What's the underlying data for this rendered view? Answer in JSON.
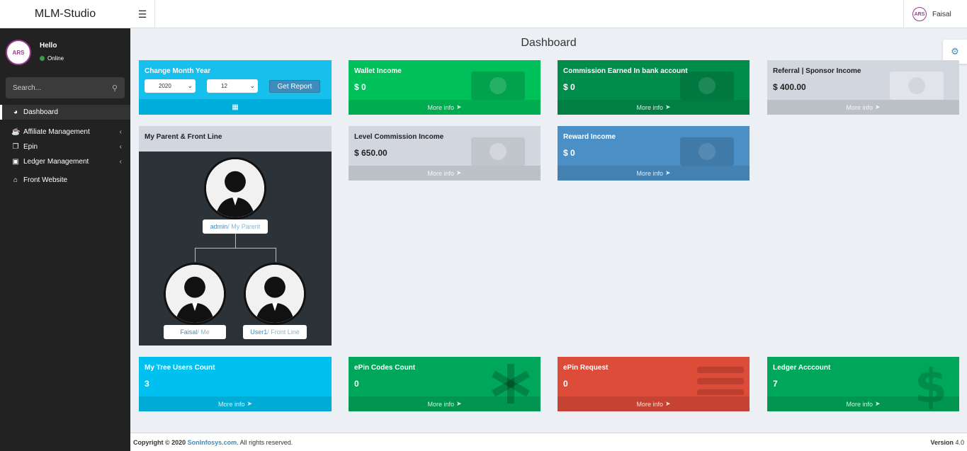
{
  "app": {
    "brand": "MLM-Studio",
    "logo_text": "ARS"
  },
  "topbar": {
    "username": "Faisal"
  },
  "sidebar": {
    "hello": "Hello",
    "status": "Online",
    "search_placeholder": "Search...",
    "items": [
      {
        "label": "Dashboard",
        "icon": "dashboard-icon"
      },
      {
        "label": "Affiliate Management",
        "icon": "coffee-icon"
      },
      {
        "label": "Epin",
        "icon": "copy-icon"
      },
      {
        "label": "Ledger Management",
        "icon": "money-icon"
      },
      {
        "label": "Front Website",
        "icon": "home-icon"
      }
    ]
  },
  "page": {
    "title": "Dashboard"
  },
  "month_box": {
    "label": "Change Month Year",
    "year": "2020",
    "month": "12",
    "button": "Get Report"
  },
  "cards": [
    {
      "label": "Wallet Income",
      "value": "$ 0",
      "more": "More info",
      "color": "#00c05a"
    },
    {
      "label": "Commission Earned In bank account",
      "value": "$ 0",
      "more": "More info",
      "color": "#008d4c"
    },
    {
      "label": "Referral | Sponsor Income",
      "value": "$ 400.00",
      "more": "More info",
      "color": "#d2d6de"
    },
    {
      "label": "Level Commission Income",
      "value": "$ 650.00",
      "more": "More info",
      "color": "#d2d6de"
    },
    {
      "label": "Reward Income",
      "value": "$ 0",
      "more": "More info",
      "color": "#4a90c7"
    },
    {
      "label": "My Tree Users Count",
      "value": "3",
      "more": "More info",
      "color": "#00c0ef"
    },
    {
      "label": "ePin Codes Count",
      "value": "0",
      "more": "More info",
      "color": "#00a65a"
    },
    {
      "label": "ePin Request",
      "value": "0",
      "more": "More info",
      "color": "#dd4b39"
    },
    {
      "label": "Ledger Acccount",
      "value": "7",
      "more": "More info",
      "color": "#00a65a"
    }
  ],
  "tree": {
    "title": "My Parent & Front Line",
    "parent": {
      "name": "admin",
      "role": " / My Parent"
    },
    "me": {
      "name": "Faisal",
      "role": " / Me"
    },
    "front": {
      "name": "User1",
      "role": " / Front Line"
    }
  },
  "footer": {
    "copyright_prefix": "Copyright © 2020 ",
    "company": "SonInfosys.com",
    "rights": ". All rights reserved.",
    "version_label": "Version",
    "version": "4.0"
  }
}
